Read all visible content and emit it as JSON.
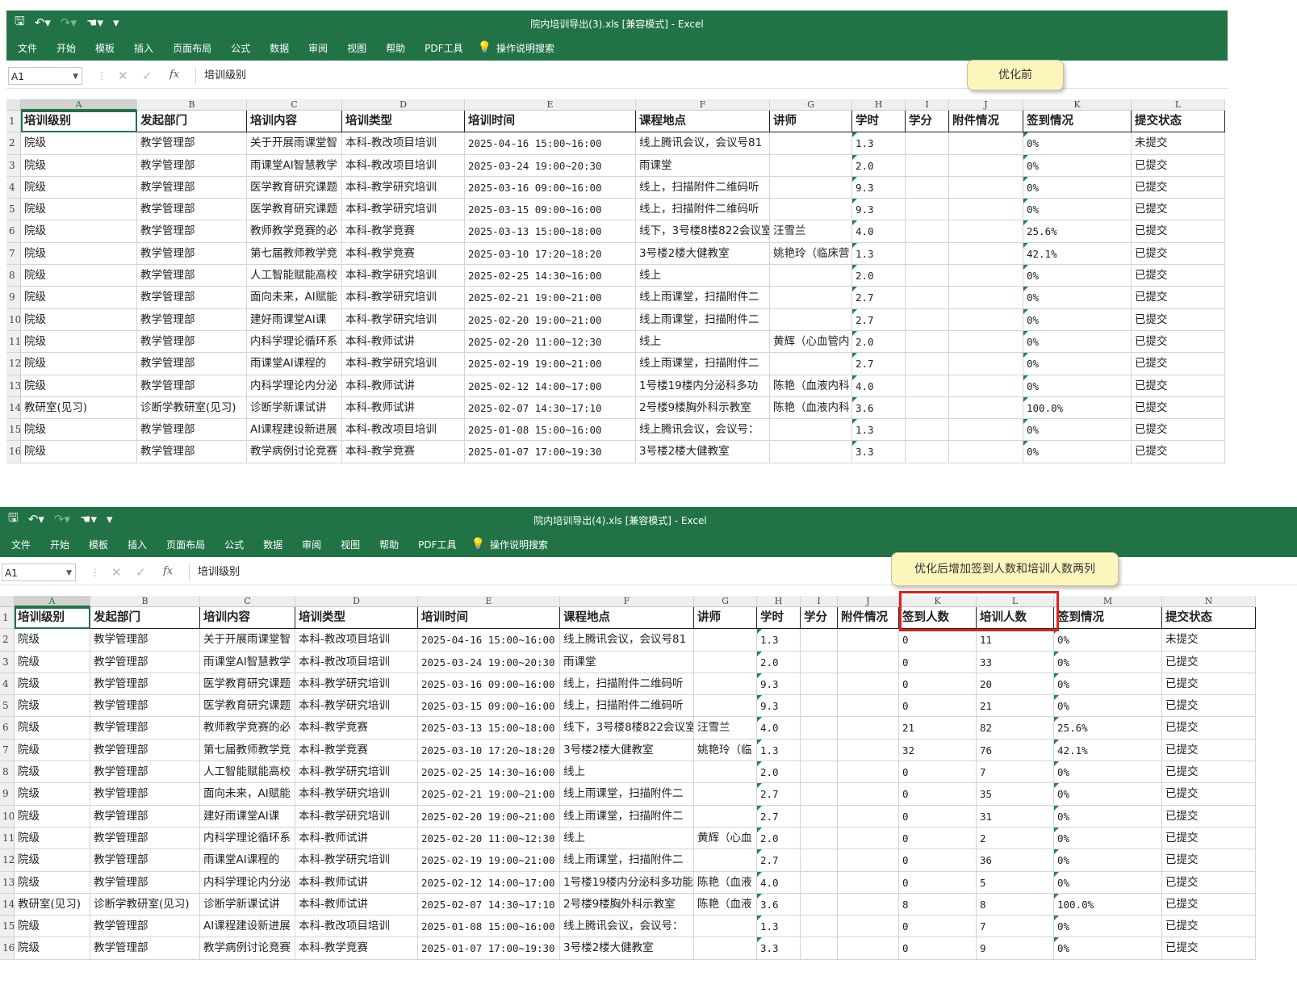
{
  "windows": [
    {
      "title": "院内培训导出(3).xls  [兼容模式]  -  Excel",
      "columns": [
        "A",
        "B",
        "C",
        "D",
        "E",
        "F",
        "G",
        "H",
        "I",
        "J",
        "K",
        "L"
      ],
      "tabs": [
        "文件",
        "开始",
        "模板",
        "插入",
        "页面布局",
        "公式",
        "数据",
        "审阅",
        "视图",
        "帮助",
        "PDF工具",
        "操作说明搜索"
      ],
      "formula": {
        "name_box": "A1",
        "value": "培训级别"
      },
      "callout": "优化前",
      "header": [
        "培训级别",
        "发起部门",
        "培训内容",
        "培训类型",
        "培训时间",
        "课程地点",
        "讲师",
        "学时",
        "学分",
        "附件情况",
        "签到情况",
        "提交状态"
      ],
      "rows": [
        [
          "院级",
          "教学管理部",
          "关于开展雨课堂智",
          "本科-教改项目培训",
          "2025-04-16 15:00~16:00",
          "线上腾讯会议，会议号81",
          "",
          "1.3",
          "",
          "",
          "0%",
          "未提交"
        ],
        [
          "院级",
          "教学管理部",
          "雨课堂AI智慧教学",
          "本科-教改项目培训",
          "2025-03-24 19:00~20:30",
          "雨课堂",
          "",
          "2.0",
          "",
          "",
          "0%",
          "已提交"
        ],
        [
          "院级",
          "教学管理部",
          "医学教育研究课题",
          "本科-教学研究培训",
          "2025-03-16 09:00~16:00",
          "线上，扫描附件二维码听",
          "",
          "9.3",
          "",
          "",
          "0%",
          "已提交"
        ],
        [
          "院级",
          "教学管理部",
          "医学教育研究课题",
          "本科-教学研究培训",
          "2025-03-15 09:00~16:00",
          "线上，扫描附件二维码听",
          "",
          "9.3",
          "",
          "",
          "0%",
          "已提交"
        ],
        [
          "院级",
          "教学管理部",
          "教师教学竞赛的必",
          "本科-教学竞赛",
          "2025-03-13 15:00~18:00",
          "线下，3号楼8楼822会议室",
          "汪雪兰",
          "4.0",
          "",
          "",
          "25.6%",
          "已提交"
        ],
        [
          "院级",
          "教学管理部",
          "第七届教师教学竞",
          "本科-教学竞赛",
          "2025-03-10 17:20~18:20",
          "3号楼2楼大健教室",
          "姚艳玲（临床营",
          "1.3",
          "",
          "",
          "42.1%",
          "已提交"
        ],
        [
          "院级",
          "教学管理部",
          "人工智能赋能高校",
          "本科-教学研究培训",
          "2025-02-25 14:30~16:00",
          "线上",
          "",
          "2.0",
          "",
          "",
          "0%",
          "已提交"
        ],
        [
          "院级",
          "教学管理部",
          "面向未来，AI赋能",
          "本科-教学研究培训",
          "2025-02-21 19:00~21:00",
          "线上雨课堂，扫描附件二",
          "",
          "2.7",
          "",
          "",
          "0%",
          "已提交"
        ],
        [
          "院级",
          "教学管理部",
          " 建好雨课堂AI课",
          "本科-教学研究培训",
          "2025-02-20 19:00~21:00",
          "线上雨课堂，扫描附件二",
          "",
          "2.7",
          "",
          "",
          "0%",
          "已提交"
        ],
        [
          "院级",
          "教学管理部",
          "内科学理论循环系",
          "本科-教师试讲",
          "2025-02-20 11:00~12:30",
          "线上",
          "黄辉（心血管内",
          "2.0",
          "",
          "",
          "0%",
          "已提交"
        ],
        [
          "院级",
          "教学管理部",
          " 雨课堂AI课程的",
          "本科-教学研究培训",
          "2025-02-19 19:00~21:00",
          "线上雨课堂，扫描附件二",
          "",
          "2.7",
          "",
          "",
          "0%",
          "已提交"
        ],
        [
          "院级",
          "教学管理部",
          "内科学理论内分泌",
          "本科-教师试讲",
          "2025-02-12 14:00~17:00",
          "1号楼19楼内分泌科多功",
          "陈艳（血液内科",
          "4.0",
          "",
          "",
          "0%",
          "已提交"
        ],
        [
          "教研室(见习)",
          "诊断学教研室(见习)",
          "诊断学新课试讲",
          "本科-教师试讲",
          "2025-02-07 14:30~17:10",
          "2号楼9楼胸外科示教室",
          "陈艳（血液内科",
          "3.6",
          "",
          "",
          "100.0%",
          "已提交"
        ],
        [
          "院级",
          "教学管理部",
          "AI课程建设新进展",
          "本科-教改项目培训",
          "2025-01-08 15:00~16:00",
          "线上腾讯会议，会议号：",
          "",
          "1.3",
          "",
          "",
          "0%",
          "已提交"
        ],
        [
          "院级",
          "教学管理部",
          "教学病例讨论竞赛",
          "本科-教学竞赛",
          "2025-01-07 17:00~19:30",
          "3号楼2楼大健教室",
          "",
          "3.3",
          "",
          "",
          "0%",
          "已提交"
        ]
      ]
    },
    {
      "title": "院内培训导出(4).xls  [兼容模式]  -  Excel",
      "columns": [
        "A",
        "B",
        "C",
        "D",
        "E",
        "F",
        "G",
        "H",
        "I",
        "J",
        "K",
        "L",
        "M",
        "N"
      ],
      "tabs": [
        "文件",
        "开始",
        "模板",
        "插入",
        "页面布局",
        "公式",
        "数据",
        "审阅",
        "视图",
        "帮助",
        "PDF工具",
        "操作说明搜索"
      ],
      "formula": {
        "name_box": "A1",
        "value": "培训级别"
      },
      "callout": "优化后增加签到人数和培训人数两列",
      "header": [
        "培训级别",
        "发起部门",
        "培训内容",
        "培训类型",
        "培训时间",
        "课程地点",
        "讲师",
        "学时",
        "学分",
        "附件情况",
        "签到人数",
        "培训人数",
        "签到情况",
        "提交状态"
      ],
      "rows": [
        [
          "院级",
          "教学管理部",
          "关于开展雨课堂智",
          "本科-教改项目培训",
          "2025-04-16 15:00~16:00",
          "线上腾讯会议，会议号81",
          "",
          "1.3",
          "",
          "",
          "0",
          "11",
          "0%",
          "未提交"
        ],
        [
          "院级",
          "教学管理部",
          "雨课堂AI智慧教学",
          "本科-教改项目培训",
          "2025-03-24 19:00~20:30",
          "雨课堂",
          "",
          "2.0",
          "",
          "",
          "0",
          "33",
          "0%",
          "已提交"
        ],
        [
          "院级",
          "教学管理部",
          "医学教育研究课题",
          "本科-教学研究培训",
          "2025-03-16 09:00~16:00",
          "线上，扫描附件二维码听",
          "",
          "9.3",
          "",
          "",
          "0",
          "20",
          "0%",
          "已提交"
        ],
        [
          "院级",
          "教学管理部",
          "医学教育研究课题",
          "本科-教学研究培训",
          "2025-03-15 09:00~16:00",
          "线上，扫描附件二维码听",
          "",
          "9.3",
          "",
          "",
          "0",
          "21",
          "0%",
          "已提交"
        ],
        [
          "院级",
          "教学管理部",
          "教师教学竞赛的必",
          "本科-教学竞赛",
          "2025-03-13 15:00~18:00",
          "线下，3号楼8楼822会议室",
          "汪雪兰",
          "4.0",
          "",
          "",
          "21",
          "82",
          "25.6%",
          "已提交"
        ],
        [
          "院级",
          "教学管理部",
          "第七届教师教学竞",
          "本科-教学竞赛",
          "2025-03-10 17:20~18:20",
          "3号楼2楼大健教室",
          "姚艳玲（临",
          "1.3",
          "",
          "",
          "32",
          "76",
          "42.1%",
          "已提交"
        ],
        [
          "院级",
          "教学管理部",
          "人工智能赋能高校",
          "本科-教学研究培训",
          "2025-02-25 14:30~16:00",
          "线上",
          "",
          "2.0",
          "",
          "",
          "0",
          "7",
          "0%",
          "已提交"
        ],
        [
          "院级",
          "教学管理部",
          "面向未来，AI赋能",
          "本科-教学研究培训",
          "2025-02-21 19:00~21:00",
          "线上雨课堂，扫描附件二",
          "",
          "2.7",
          "",
          "",
          "0",
          "35",
          "0%",
          "已提交"
        ],
        [
          "院级",
          "教学管理部",
          " 建好雨课堂AI课",
          "本科-教学研究培训",
          "2025-02-20 19:00~21:00",
          "线上雨课堂，扫描附件二",
          "",
          "2.7",
          "",
          "",
          "0",
          "31",
          "0%",
          "已提交"
        ],
        [
          "院级",
          "教学管理部",
          "内科学理论循环系",
          "本科-教师试讲",
          "2025-02-20 11:00~12:30",
          "线上",
          "黄辉（心血",
          "2.0",
          "",
          "",
          "0",
          "2",
          "0%",
          "已提交"
        ],
        [
          "院级",
          "教学管理部",
          " 雨课堂AI课程的",
          "本科-教学研究培训",
          "2025-02-19 19:00~21:00",
          "线上雨课堂，扫描附件二",
          "",
          "2.7",
          "",
          "",
          "0",
          "36",
          "0%",
          "已提交"
        ],
        [
          "院级",
          "教学管理部",
          "内科学理论内分泌",
          "本科-教师试讲",
          "2025-02-12 14:00~17:00",
          "1号楼19楼内分泌科多功能",
          "陈艳（血液",
          "4.0",
          "",
          "",
          "0",
          "5",
          "0%",
          "已提交"
        ],
        [
          "教研室(见习)",
          "诊断学教研室(见习)",
          "诊断学新课试讲",
          "本科-教师试讲",
          "2025-02-07 14:30~17:10",
          "2号楼9楼胸外科示教室",
          "陈艳（血液",
          "3.6",
          "",
          "",
          "8",
          "8",
          "100.0%",
          "已提交"
        ],
        [
          "院级",
          "教学管理部",
          "AI课程建设新进展",
          "本科-教改项目培训",
          "2025-01-08 15:00~16:00",
          "线上腾讯会议，会议号：",
          "",
          "1.3",
          "",
          "",
          "0",
          "7",
          "0%",
          "已提交"
        ],
        [
          "院级",
          "教学管理部",
          "教学病例讨论竞赛",
          "本科-教学竞赛",
          "2025-01-07 17:00~19:30",
          "3号楼2楼大健教室",
          "",
          "3.3",
          "",
          "",
          "0",
          "9",
          "0%",
          "已提交"
        ]
      ]
    }
  ]
}
